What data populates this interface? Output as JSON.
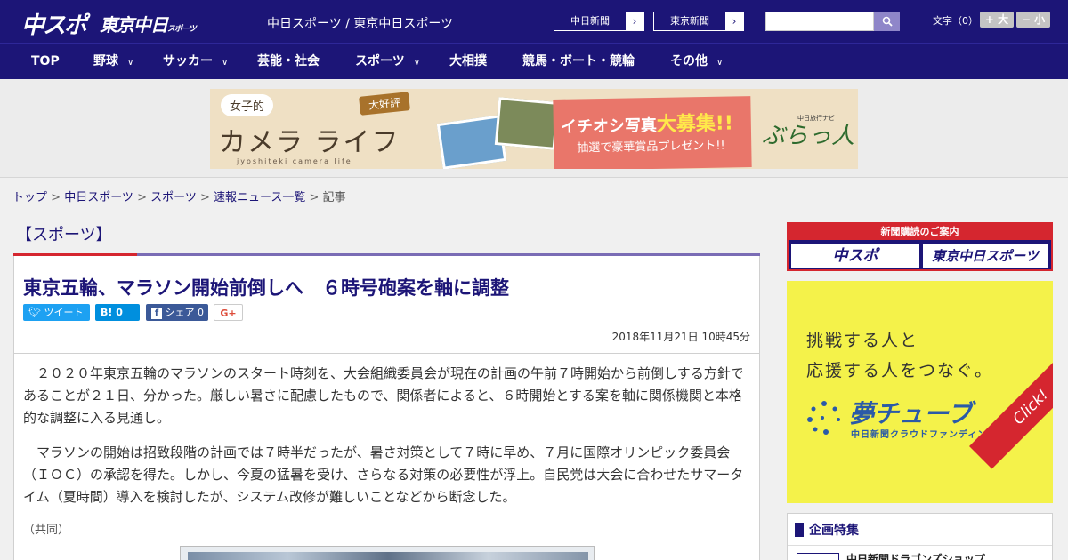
{
  "header": {
    "logo_chuspo": "中スポ",
    "logo_tokyo": "東京中日",
    "logo_tokyo_sub": "スポーツ",
    "site_title": "中日スポーツ / 東京中日スポーツ",
    "chunichi_link": "中日新聞",
    "tokyo_link": "東京新聞",
    "search_placeholder": "",
    "font_size_label": "文字（0）",
    "font_plus": "+ 大",
    "font_minus": "− 小"
  },
  "nav": {
    "items": [
      {
        "label": "TOP",
        "has_dropdown": false
      },
      {
        "label": "野球",
        "has_dropdown": true
      },
      {
        "label": "サッカー",
        "has_dropdown": true
      },
      {
        "label": "芸能・社会",
        "has_dropdown": false
      },
      {
        "label": "スポーツ",
        "has_dropdown": true
      },
      {
        "label": "大相撲",
        "has_dropdown": false
      },
      {
        "label": "競馬・ボート・競輪",
        "has_dropdown": false
      },
      {
        "label": "その他",
        "has_dropdown": true
      }
    ]
  },
  "banner": {
    "joshi": "女子的",
    "kamera": "カメラ  ライフ",
    "sub": "jyoshiteki camera life",
    "badge": "大好評",
    "line1_a": "イチオシ写真",
    "line1_b": "大募集!!",
    "line2": "抽選で豪華賞品プレゼント!!",
    "nabi": "中日旅行ナビ",
    "brand": "ぶらっ人"
  },
  "breadcrumb": {
    "items": [
      "トップ",
      "中日スポーツ",
      "スポーツ",
      "速報ニュース一覧"
    ],
    "current": "記事"
  },
  "article": {
    "category": "【スポーツ】",
    "headline": "東京五輪、マラソン開始前倒しへ　６時号砲案を軸に調整",
    "share": {
      "tweet": "ツイート",
      "hatena": "B! 0",
      "facebook": "シェア 0",
      "gplus": "G+"
    },
    "timestamp": "2018年11月21日 10時45分",
    "paragraphs": [
      "２０２０年東京五輪のマラソンのスタート時刻を、大会組織委員会が現在の計画の午前７時開始から前倒しする方針であることが２１日、分かった。厳しい暑さに配慮したもので、関係者によると、６時開始とする案を軸に関係機関と本格的な調整に入る見通し。",
      "マラソンの開始は招致段階の計画では７時半だったが、暑さ対策として７時に早め、７月に国際オリンピック委員会（ＩＯＣ）の承認を得た。しかし、今夏の猛暑を受け、さらなる対策の必要性が浮上。自民党は大会に合わせたサマータイム（夏時間）導入を検討したが、システム改修が難しいことなどから断念した。"
    ],
    "credit": "（共同）"
  },
  "sidebar": {
    "subscribe_head": "新聞購読のご案内",
    "subscribe_a": "中スポ",
    "subscribe_b": "東京中日スポーツ",
    "yume_line1": "挑戦する人と",
    "yume_line2": "応援する人をつなぐ。",
    "yume_brand": "夢チューブ",
    "yume_sub": "中日新聞クラウドファンディング",
    "yume_click": "Click!",
    "feature_title": "企画特集",
    "feature_item": "中日新聞ドラゴンズショップ"
  },
  "colors": {
    "header_bg": "#1c1577",
    "accent_red": "#d5262f",
    "accent_purple": "#7a6cb5",
    "yume_bg": "#f4f24a"
  }
}
